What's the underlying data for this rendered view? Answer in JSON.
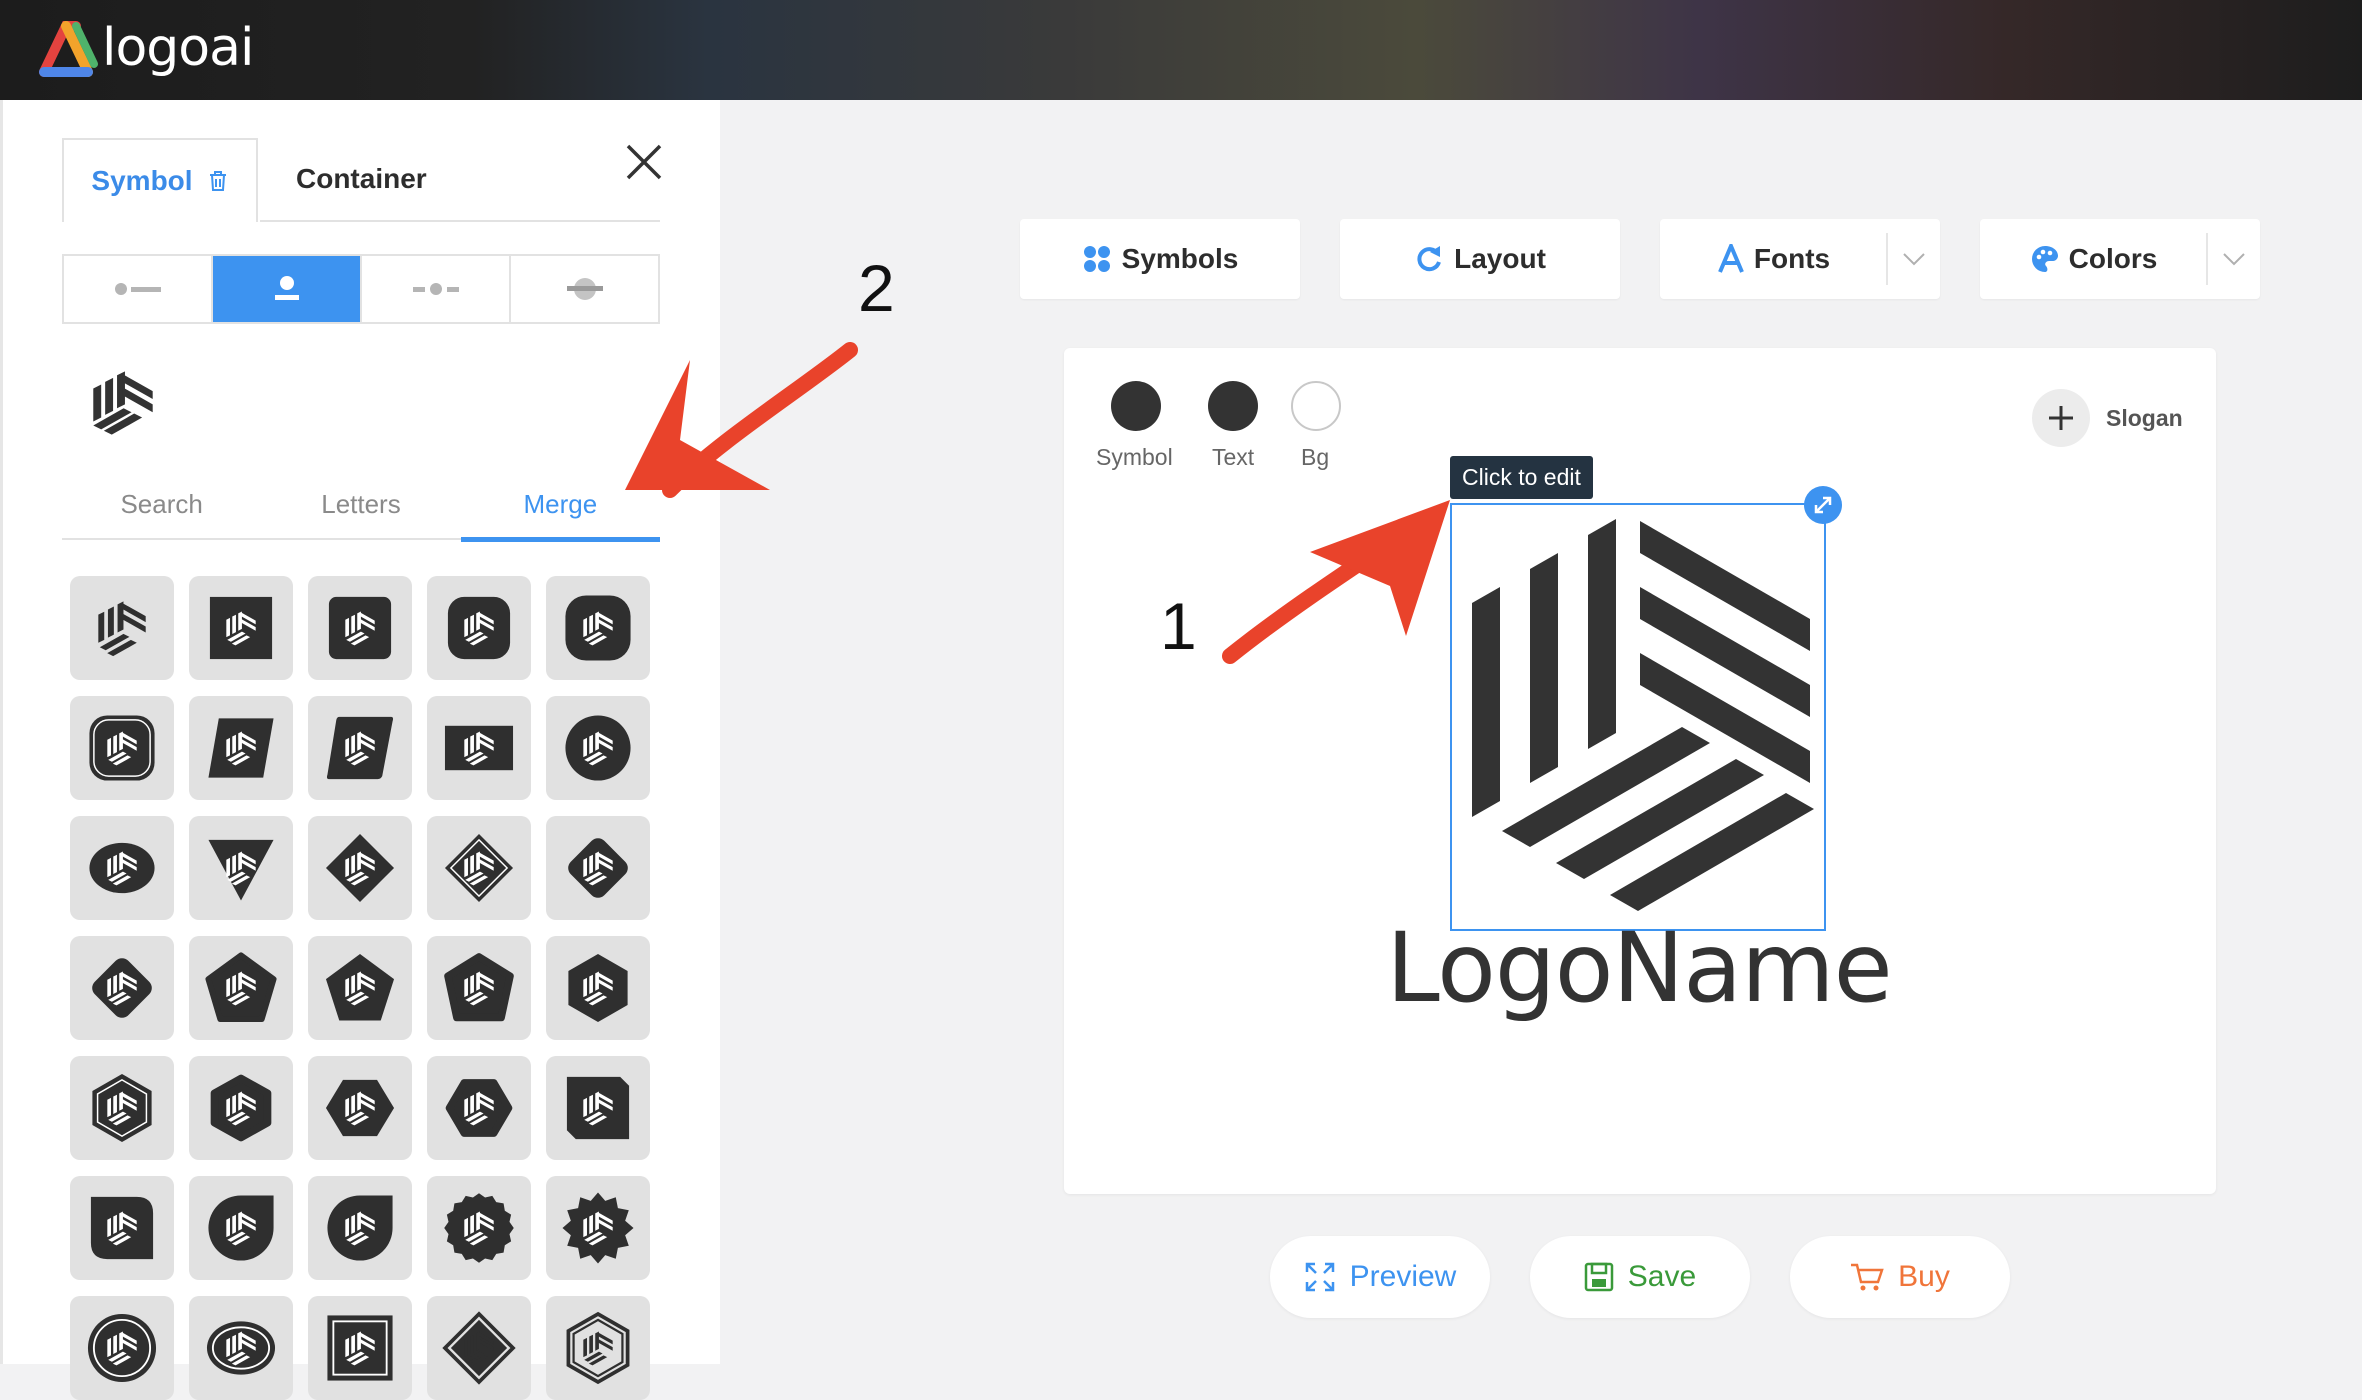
{
  "app": {
    "name": "logoai"
  },
  "panel": {
    "tabs": [
      {
        "label": "Symbol",
        "icon": "trash-icon"
      },
      {
        "label": "Container"
      }
    ],
    "layout_options": [
      "symbol-left",
      "symbol-top",
      "symbol-middle",
      "symbol-behind"
    ],
    "layout_selected": "symbol-top",
    "subtabs": [
      {
        "label": "Search"
      },
      {
        "label": "Letters"
      },
      {
        "label": "Merge",
        "active": true
      }
    ],
    "container_shapes": [
      "none",
      "square",
      "rounded-square",
      "squircle",
      "rounded-square-large",
      "rounded-square-outline",
      "parallelogram",
      "parallelogram-rounded",
      "rectangle",
      "circle",
      "ellipse",
      "triangle-down",
      "diamond",
      "diamond-outline",
      "diamond-rounded",
      "diamond-rounded-alt",
      "pentagon-rounded",
      "pentagon",
      "pentagon-soft",
      "hexagon",
      "hexagon-outline",
      "hexagon-rounded",
      "hexagon-flat",
      "hexagon-flat-rounded",
      "square-cut",
      "square-leaf",
      "circle-leaf",
      "leaf",
      "badge",
      "badge-star",
      "circle-ring",
      "ellipse-ring",
      "square-frame",
      "diamond-frame",
      "hexagon-frame"
    ]
  },
  "toolbar": {
    "symbols": "Symbols",
    "layout": "Layout",
    "fonts": "Fonts",
    "colors": "Colors"
  },
  "canvas": {
    "swatches": [
      {
        "label": "Symbol",
        "color": "#333333"
      },
      {
        "label": "Text",
        "color": "#333333"
      },
      {
        "label": "Bg",
        "color": "#ffffff"
      }
    ],
    "slogan_label": "Slogan",
    "tooltip": "Click to edit",
    "logo_name": "LogoName"
  },
  "annotations": {
    "step1": "1",
    "step2": "2"
  },
  "actions": {
    "preview": "Preview",
    "save": "Save",
    "buy": "Buy"
  },
  "colors": {
    "accent": "#3d93f0",
    "save_green": "#3a9a3a",
    "buy_orange": "#f0753a",
    "arrow_red": "#e9432b",
    "symbol_dark": "#333333"
  }
}
